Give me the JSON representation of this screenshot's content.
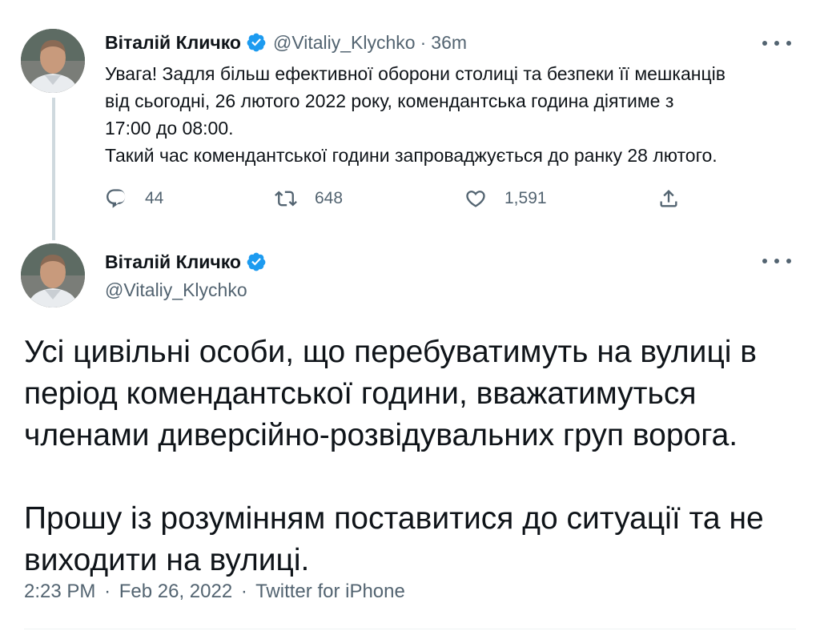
{
  "tweet1": {
    "author_name": "Віталій Кличко",
    "handle": "@Vitaliy_Klychko",
    "separator": "·",
    "time": "36m",
    "text_lines": [
      "Увага! Задля більш ефективної оборони столиці та безпеки її мешканців",
      "від сьогодні, 26 лютого 2022 року, комендантська година діятиме з",
      "17:00 до 08:00.",
      "Такий час комендантської години запроваджується до ранку 28 лютого."
    ],
    "actions": {
      "replies": "44",
      "retweets": "648",
      "likes": "1,591"
    }
  },
  "tweet2": {
    "author_name": "Віталій Кличко",
    "handle": "@Vitaliy_Klychko",
    "paragraph1_lines": [
      "Усі цивільні особи, що перебуватимуть на вулиці в",
      "період комендантської години, вважатимуться",
      "членами диверсійно-розвідувальних груп ворога."
    ],
    "paragraph2_lines": [
      "Прошу із розумінням поставитися до ситуації та не",
      "виходити на вулиці."
    ],
    "meta": {
      "time": "2:23 PM",
      "dot1": "·",
      "date": "Feb 26, 2022",
      "dot2": "·",
      "source": "Twitter for iPhone"
    }
  },
  "colors": {
    "verified_blue": "#1d9bf0",
    "muted_text": "#536471",
    "thread_line": "#cfd9de"
  },
  "icons": {
    "verified": "verified-badge-icon",
    "reply": "reply-icon",
    "retweet": "retweet-icon",
    "like": "heart-icon",
    "share": "share-icon",
    "more": "more-dots-icon"
  }
}
